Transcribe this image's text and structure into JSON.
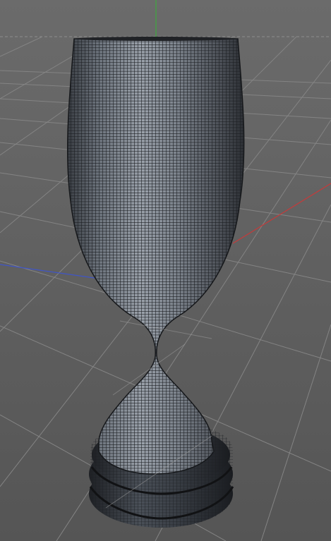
{
  "viewport": {
    "kind": "3d-perspective-viewport",
    "background_top": "#6a6a6a",
    "background_bottom": "#545454",
    "grid_color": "#8a8a8a",
    "horizon_guide_color": "#9a9a9a"
  },
  "axes": {
    "x_color": "#c63a3a",
    "y_color": "#3ea83e",
    "z_color": "#3f55c8"
  },
  "model": {
    "object": "goblet-mesh",
    "shading": "wireframe-on-shaded",
    "surface_color": "#8a9099",
    "wire_color": "#1e2024"
  }
}
